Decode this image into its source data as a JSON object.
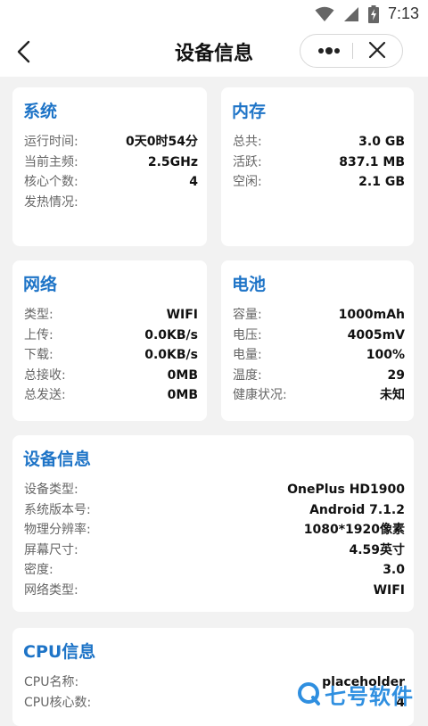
{
  "status": {
    "time": "7:13"
  },
  "header": {
    "title": "设备信息"
  },
  "cards": {
    "system": {
      "title": "系统",
      "rows": [
        {
          "label": "运行时间:",
          "value": "0天0时54分"
        },
        {
          "label": "当前主频:",
          "value": "2.5GHz"
        },
        {
          "label": "核心个数:",
          "value": "4"
        },
        {
          "label": "发热情况:",
          "value": ""
        }
      ]
    },
    "memory": {
      "title": "内存",
      "rows": [
        {
          "label": "总共:",
          "value": "3.0 GB"
        },
        {
          "label": "活跃:",
          "value": "837.1 MB"
        },
        {
          "label": "空闲:",
          "value": "2.1 GB"
        }
      ]
    },
    "network": {
      "title": "网络",
      "rows": [
        {
          "label": "类型:",
          "value": "WIFI"
        },
        {
          "label": "上传:",
          "value": "0.0KB/s"
        },
        {
          "label": "下载:",
          "value": "0.0KB/s"
        },
        {
          "label": "总接收:",
          "value": "0MB"
        },
        {
          "label": "总发送:",
          "value": "0MB"
        }
      ]
    },
    "battery": {
      "title": "电池",
      "rows": [
        {
          "label": "容量:",
          "value": "1000mAh"
        },
        {
          "label": "电压:",
          "value": "4005mV"
        },
        {
          "label": "电量:",
          "value": "100%"
        },
        {
          "label": "温度:",
          "value": "29"
        },
        {
          "label": "健康状况:",
          "value": "未知"
        }
      ]
    },
    "device": {
      "title": "设备信息",
      "rows": [
        {
          "label": "设备类型:",
          "value": "OnePlus HD1900"
        },
        {
          "label": "系统版本号:",
          "value": "Android 7.1.2"
        },
        {
          "label": "物理分辨率:",
          "value": "1080*1920像素"
        },
        {
          "label": "屏幕尺寸:",
          "value": "4.59英寸"
        },
        {
          "label": "密度:",
          "value": "3.0"
        },
        {
          "label": "网络类型:",
          "value": "WIFI"
        }
      ]
    },
    "cpu": {
      "title": "CPU信息",
      "rows": [
        {
          "label": "CPU名称:",
          "value": "placeholder"
        },
        {
          "label": "CPU核心数:",
          "value": "4"
        }
      ]
    }
  },
  "watermark": {
    "text": "七号软件"
  },
  "colors": {
    "accent": "#1e74c7",
    "background": "#f2f2f2",
    "card": "#ffffff"
  },
  "icons": {
    "back": "chevron-left-icon",
    "more": "more-dots-icon",
    "close": "close-icon",
    "wifi": "wifi-icon",
    "signal": "signal-icon",
    "battery": "battery-charging-icon"
  }
}
